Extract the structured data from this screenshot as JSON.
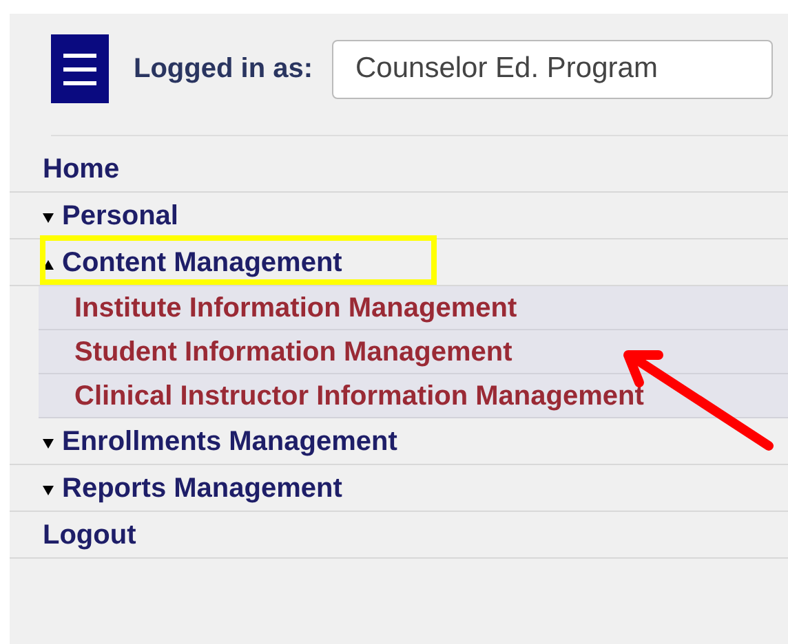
{
  "header": {
    "label": "Logged in as:",
    "account_field": {
      "value": "Counselor Ed. Program"
    }
  },
  "menu": [
    {
      "label": "Home",
      "kind": "link"
    },
    {
      "label": "Personal",
      "kind": "group",
      "expanded": false
    },
    {
      "label": "Content Management",
      "kind": "group",
      "expanded": true,
      "highlighted": true,
      "children": [
        {
          "label": "Institute Information Management",
          "pointed": false
        },
        {
          "label": "Student Information Management",
          "pointed": true
        },
        {
          "label": "Clinical Instructor Information Management",
          "pointed": false
        }
      ]
    },
    {
      "label": "Enrollments Management",
      "kind": "group",
      "expanded": false
    },
    {
      "label": "Reports Management",
      "kind": "group",
      "expanded": false
    },
    {
      "label": "Logout",
      "kind": "link"
    }
  ]
}
